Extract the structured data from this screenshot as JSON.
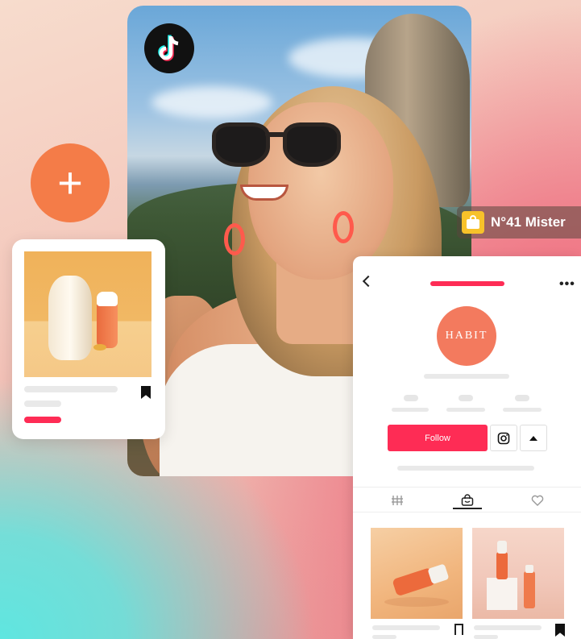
{
  "brand_badge": {
    "icon": "tiktok-logo"
  },
  "add_button": {
    "label": "+"
  },
  "shop_badge": {
    "icon": "shopping-bag-icon",
    "label": "N°41 Mister"
  },
  "profile": {
    "brand_name": "HABIT",
    "follow_label": "Follow",
    "instagram_icon": "instagram-icon",
    "more_icon": "more-icon",
    "back_icon": "back-icon",
    "tabs": [
      {
        "icon": "videos-icon"
      },
      {
        "icon": "shop-icon"
      },
      {
        "icon": "heart-icon"
      }
    ],
    "products": [
      {
        "image": "orange lip gloss bottle"
      },
      {
        "image": "orange serum bottles on pedestal"
      }
    ]
  },
  "colors": {
    "accent_pink": "#fe2c55",
    "orange": "#f47c48",
    "shop_yellow": "#f7c22a"
  }
}
